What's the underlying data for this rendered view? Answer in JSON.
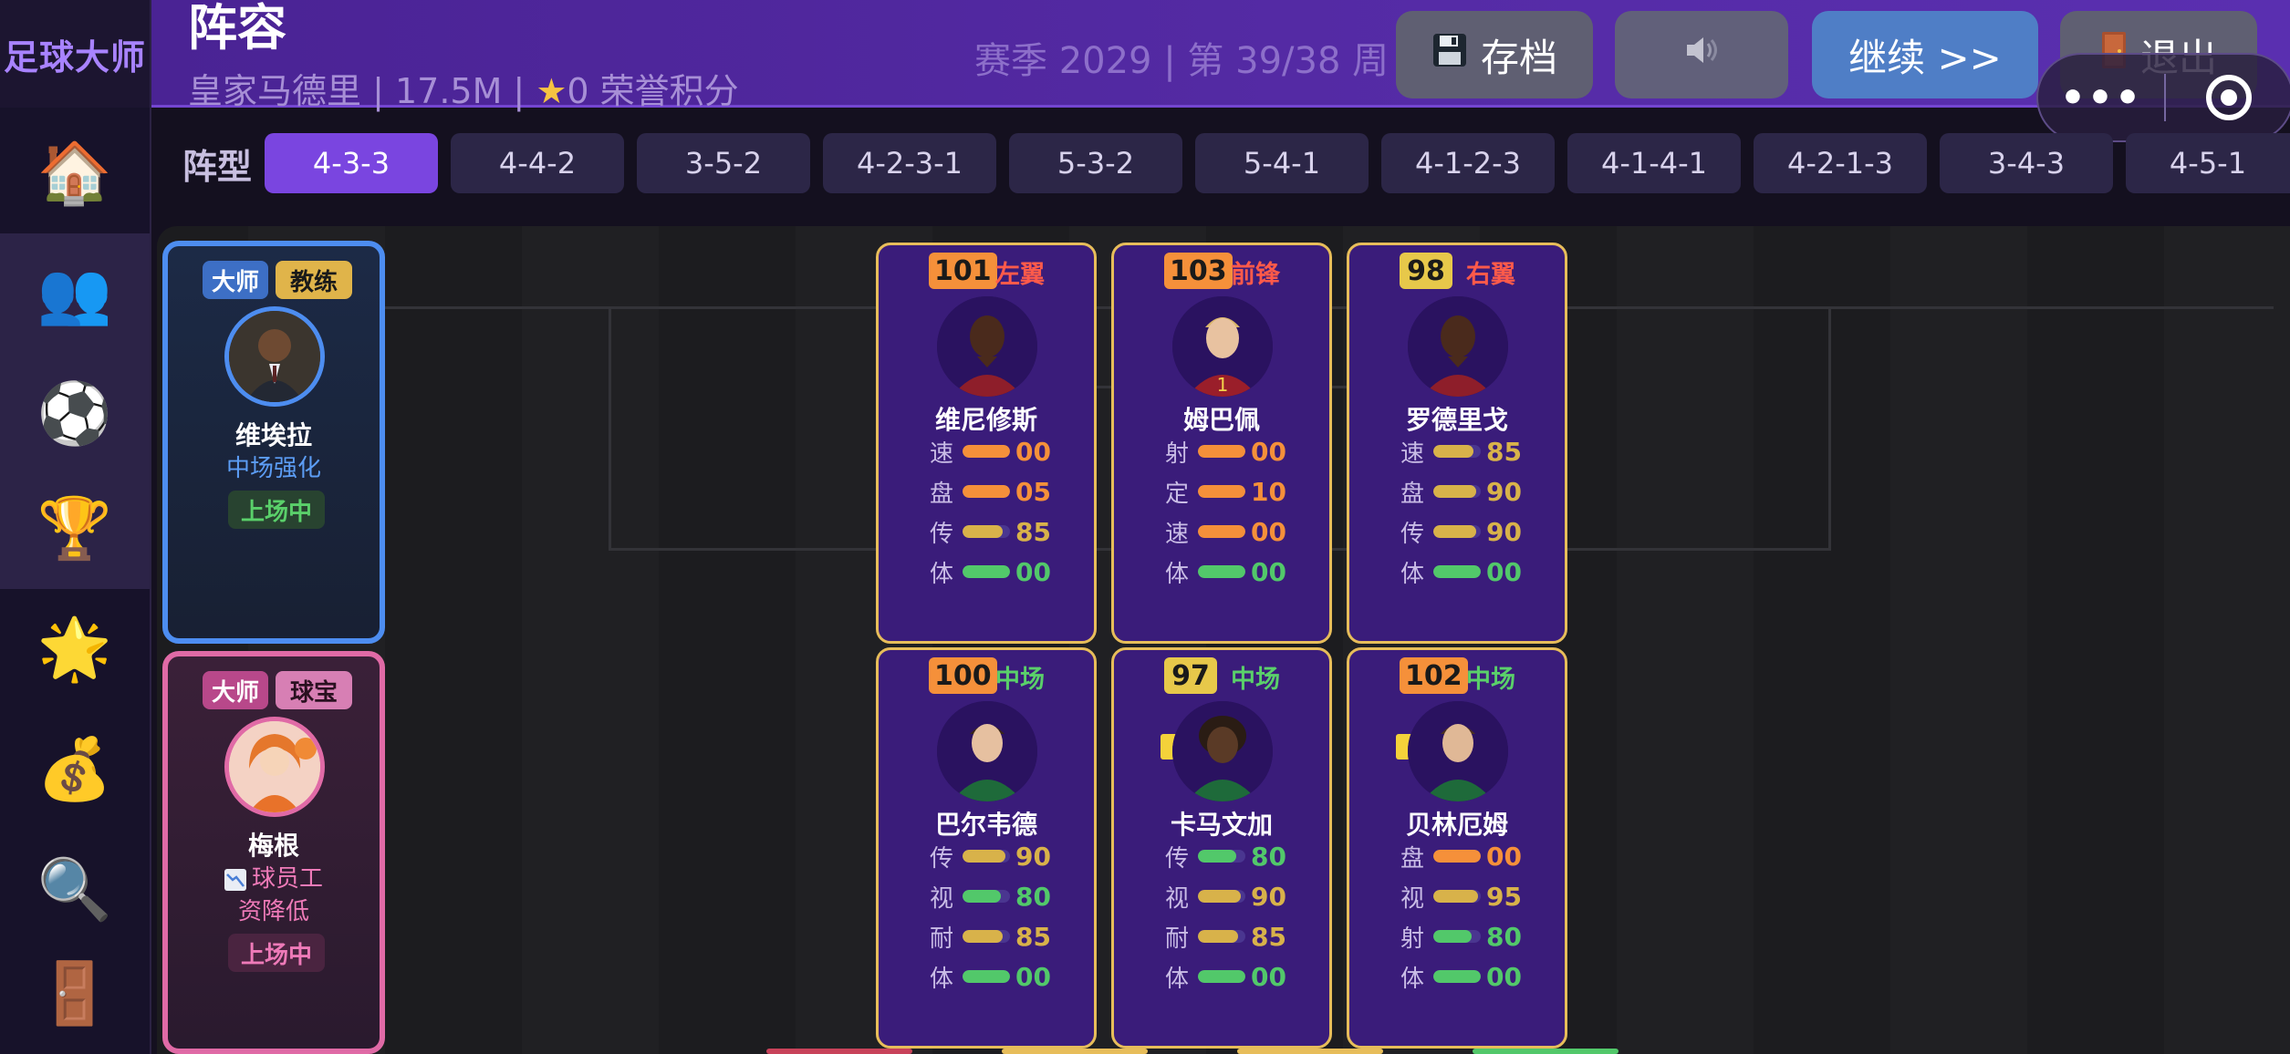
{
  "app": {
    "brand": "足球大师"
  },
  "header": {
    "title": "阵容",
    "subtitle_team": "皇家马德里 | 17.5M | ",
    "subtitle_star": "★",
    "subtitle_points": "0 荣誉积分",
    "season": "赛季 2029 | 第 39/38 周",
    "save_label": "存档",
    "continue_label": "继续  >>",
    "exit_label": "退出",
    "capsule_more": "•••"
  },
  "sidebar": [
    {
      "name": "home",
      "icon": "house-icon",
      "glyph": "🏠"
    },
    {
      "name": "squad",
      "icon": "people-icon",
      "glyph": "👥"
    },
    {
      "name": "match",
      "icon": "soccer-ball-icon",
      "glyph": "⚽"
    },
    {
      "name": "trophy",
      "icon": "trophy-icon",
      "glyph": "🏆"
    },
    {
      "name": "star",
      "icon": "star-burst-icon",
      "glyph": "🌟"
    },
    {
      "name": "money",
      "icon": "money-bag-icon",
      "glyph": "💰"
    },
    {
      "name": "search",
      "icon": "magnifier-icon",
      "glyph": "🔍"
    },
    {
      "name": "door",
      "icon": "door-icon",
      "glyph": "🚪"
    }
  ],
  "formation": {
    "label": "阵型",
    "selected": "4-3-3",
    "options": [
      "4-3-3",
      "4-4-2",
      "3-5-2",
      "4-2-3-1",
      "5-3-2",
      "5-4-1",
      "4-1-2-3",
      "4-1-4-1",
      "4-2-1-3",
      "3-4-3",
      "4-5-1"
    ]
  },
  "coaches": [
    {
      "tag1": "大师",
      "tag2": "教练",
      "name": "维埃拉",
      "skill": "中场强化",
      "status": "上场中"
    },
    {
      "tag1": "大师",
      "tag2": "球宝",
      "name": "梅根",
      "skill_line1": "球员工",
      "skill_line2": "资降低",
      "status": "上场中"
    }
  ],
  "players": [
    {
      "rating": "101",
      "position": "左翼",
      "name": "维尼修斯",
      "stats": [
        {
          "label": "速",
          "value": "00"
        },
        {
          "label": "盘",
          "value": "05"
        },
        {
          "label": "传",
          "value": "85"
        },
        {
          "label": "体",
          "value": "00"
        }
      ]
    },
    {
      "rating": "103",
      "position": "前锋",
      "name": "姆巴佩",
      "stats": [
        {
          "label": "射",
          "value": "00"
        },
        {
          "label": "定",
          "value": "10"
        },
        {
          "label": "速",
          "value": "00"
        },
        {
          "label": "体",
          "value": "00"
        }
      ]
    },
    {
      "rating": "98",
      "position": "右翼",
      "name": "罗德里戈",
      "stats": [
        {
          "label": "速",
          "value": "85"
        },
        {
          "label": "盘",
          "value": "90"
        },
        {
          "label": "传",
          "value": "90"
        },
        {
          "label": "体",
          "value": "00"
        }
      ]
    },
    {
      "rating": "100",
      "position": "中场",
      "name": "巴尔韦德",
      "stats": [
        {
          "label": "传",
          "value": "90"
        },
        {
          "label": "视",
          "value": "80"
        },
        {
          "label": "耐",
          "value": "85"
        },
        {
          "label": "体",
          "value": "00"
        }
      ]
    },
    {
      "rating": "97",
      "position": "中场",
      "name": "卡马文加",
      "stats": [
        {
          "label": "传",
          "value": "80"
        },
        {
          "label": "视",
          "value": "90"
        },
        {
          "label": "耐",
          "value": "85"
        },
        {
          "label": "体",
          "value": "00"
        }
      ]
    },
    {
      "rating": "102",
      "position": "中场",
      "name": "贝林厄姆",
      "stats": [
        {
          "label": "盘",
          "value": "00"
        },
        {
          "label": "视",
          "value": "95"
        },
        {
          "label": "射",
          "value": "80"
        },
        {
          "label": "体",
          "value": "00"
        }
      ]
    }
  ],
  "colors": {
    "accent_purple": "#7a45e0",
    "card_border_gold": "#e7bd5a",
    "stat_orange": "#f5903a",
    "stat_gold": "#d8b24a",
    "stat_green": "#52c86a",
    "pos_red": "#ff5a4a",
    "pos_green": "#5ad06a",
    "coach_blue": "#4d8df0",
    "coach_pink": "#e06aa6"
  }
}
